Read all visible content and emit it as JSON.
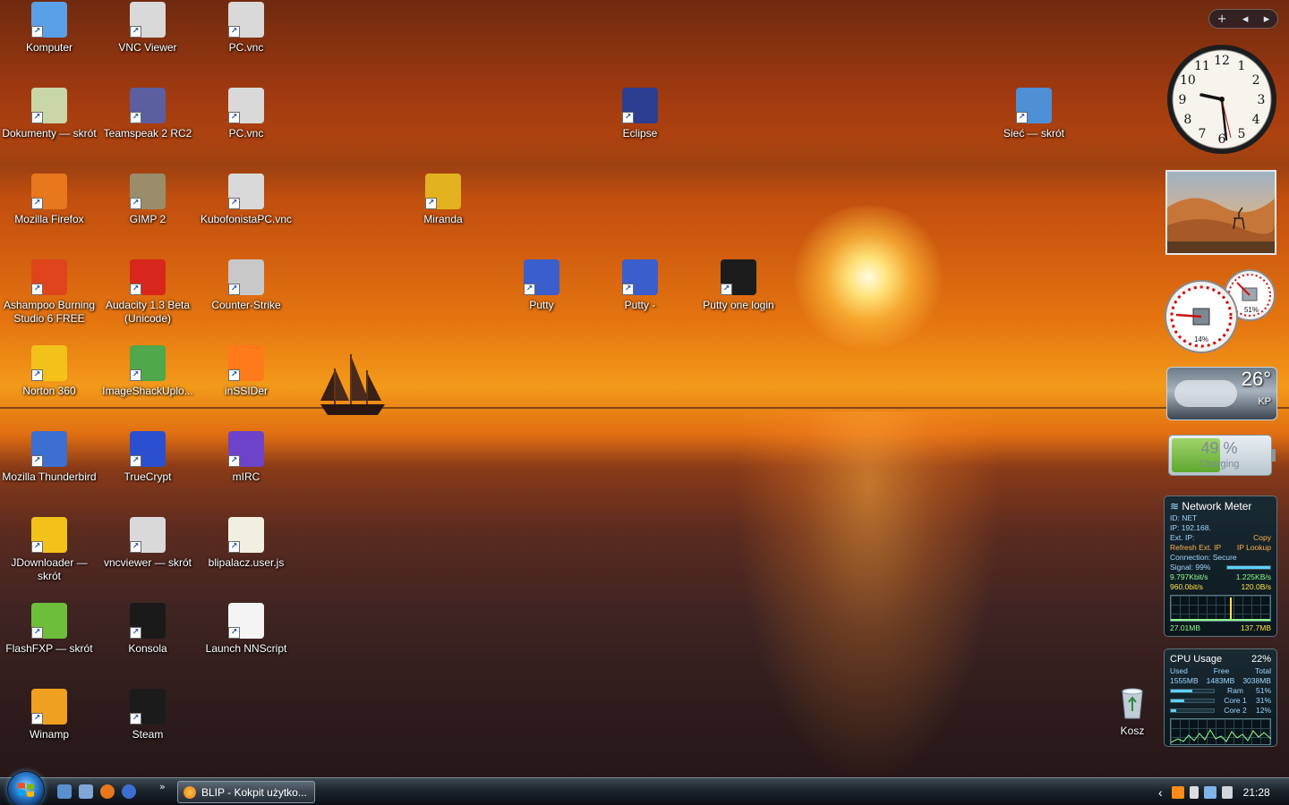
{
  "desktop": {
    "icons": [
      {
        "label": "Komputer",
        "icon": "computer-icon",
        "color": "#5aa0e6"
      },
      {
        "label": "VNC Viewer",
        "icon": "vnc-icon",
        "color": "#d9d9d9"
      },
      {
        "label": "PC.vnc",
        "icon": "vnc-file-icon",
        "color": "#d9d9d9"
      },
      {
        "label": "Dokumenty — skrót",
        "icon": "documents-folder-icon",
        "color": "#c9d6a8"
      },
      {
        "label": "Teamspeak 2 RC2",
        "icon": "teamspeak-icon",
        "color": "#5b5fa0"
      },
      {
        "label": "PC.vnc",
        "icon": "vnc-file-icon",
        "color": "#d9d9d9"
      },
      {
        "label": "Eclipse",
        "icon": "eclipse-icon",
        "color": "#2c3e91"
      },
      {
        "label": "Sieć — skrót",
        "icon": "network-icon",
        "color": "#4f8fd6"
      },
      {
        "label": "Mozilla Firefox",
        "icon": "firefox-icon",
        "color": "#e8771d"
      },
      {
        "label": "GIMP 2",
        "icon": "gimp-icon",
        "color": "#9a8d6a"
      },
      {
        "label": "KubofonistaPC.vnc",
        "icon": "vnc-file-icon",
        "color": "#d9d9d9"
      },
      {
        "label": "Miranda",
        "icon": "miranda-icon",
        "color": "#e2b11f"
      },
      {
        "label": "Ashampoo Burning Studio 6 FREE",
        "icon": "ashampoo-icon",
        "color": "#e0441c"
      },
      {
        "label": "Audacity 1.3 Beta (Unicode)",
        "icon": "audacity-icon",
        "color": "#d9261c"
      },
      {
        "label": "Counter-Strike",
        "icon": "counter-strike-icon",
        "color": "#c8c8c8"
      },
      {
        "label": "Putty",
        "icon": "putty-icon",
        "color": "#3a5fcd"
      },
      {
        "label": "Putty -",
        "icon": "putty-icon",
        "color": "#3a5fcd"
      },
      {
        "label": "Putty one login",
        "icon": "putty-spy-icon",
        "color": "#1c1c1c"
      },
      {
        "label": "Norton 360",
        "icon": "norton-icon",
        "color": "#f2c21a"
      },
      {
        "label": "ImageShackUplo...",
        "icon": "imageshack-icon",
        "color": "#4fa84b"
      },
      {
        "label": "inSSIDer",
        "icon": "inssider-icon",
        "color": "#ff7a1a"
      },
      {
        "label": "Mozilla Thunderbird",
        "icon": "thunderbird-icon",
        "color": "#3c6fcf"
      },
      {
        "label": "TrueCrypt",
        "icon": "truecrypt-icon",
        "color": "#2a4fcf"
      },
      {
        "label": "mIRC",
        "icon": "mirc-icon",
        "color": "#6d43c9"
      },
      {
        "label": "JDownloader — skrót",
        "icon": "jdownloader-icon",
        "color": "#f2c21a"
      },
      {
        "label": "vncviewer — skrót",
        "icon": "vnc-icon",
        "color": "#d9d9d9"
      },
      {
        "label": "blipalacz.user.js",
        "icon": "script-file-icon",
        "color": "#f1efe0"
      },
      {
        "label": "FlashFXP — skrót",
        "icon": "flashfxp-icon",
        "color": "#6dbf3b"
      },
      {
        "label": "Konsola",
        "icon": "console-icon",
        "color": "#1a1a1a"
      },
      {
        "label": "Launch NNScript",
        "icon": "nnscript-icon",
        "color": "#f4f4f4"
      },
      {
        "label": "Winamp",
        "icon": "winamp-icon",
        "color": "#f0a020"
      },
      {
        "label": "Steam",
        "icon": "steam-icon",
        "color": "#1b1b1b"
      }
    ],
    "recycle_bin": {
      "label": "Kosz",
      "icon": "recycle-bin-icon"
    }
  },
  "sidebar": {
    "controls": {
      "add": "+",
      "prev": "◂",
      "next": "▸"
    },
    "clock": {
      "numerals": [
        "12",
        "1",
        "2",
        "3",
        "4",
        "5",
        "6",
        "7",
        "8",
        "9",
        "10",
        "11"
      ],
      "time": "21:28"
    },
    "meters": {
      "cpu_percent": "14%",
      "ram_percent": "51%"
    },
    "weather": {
      "temperature": "26°",
      "location": "KP"
    },
    "battery": {
      "percent": "49 %",
      "status": "Charging"
    },
    "network_meter": {
      "title": "Network Meter",
      "id_label": "ID:",
      "id_value": "NET",
      "ip_label": "IP: 192.168.",
      "ext_ip_label": "Ext. IP:",
      "copy": "Copy",
      "refresh": "Refresh Ext. IP",
      "ip_lookup": "IP Lookup",
      "connection": "Connection: Secure",
      "signal": "Signal: 99%",
      "signal_level": 0.99,
      "up_speed": "9.797Kbit/s",
      "up_total": "1.225KB/s",
      "down_speed": "960.0bit/s",
      "down_total": "120.0B/s",
      "sent": "27.01MB",
      "received": "137.7MB"
    },
    "cpu_meter": {
      "title": "CPU Usage",
      "percent": "22%",
      "used_label": "Used",
      "free_label": "Free",
      "total_label": "Total",
      "used": "1555MB",
      "free": "1483MB",
      "total": "3038MB",
      "rows": [
        {
          "name": "Ram",
          "value": "51%",
          "level": 0.51
        },
        {
          "name": "Core 1",
          "value": "31%",
          "level": 0.31
        },
        {
          "name": "Core 2",
          "value": "12%",
          "level": 0.12
        }
      ]
    }
  },
  "taskbar": {
    "active_window": "BLIP - Kokpit użytko...",
    "more": "»",
    "tray_chevron": "‹",
    "clock": "21:28"
  }
}
